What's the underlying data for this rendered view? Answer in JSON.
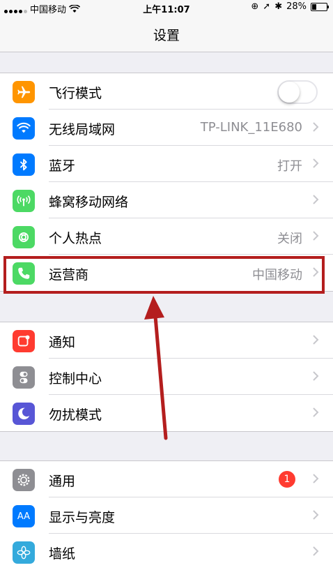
{
  "status_bar": {
    "carrier": "中国移动",
    "time": "上午11:07",
    "battery": "28%",
    "battery_level": 0.28,
    "icons": [
      "signal-dots",
      "wifi-icon",
      "orientation-lock-icon",
      "location-icon",
      "bluetooth-icon",
      "battery-icon"
    ]
  },
  "nav": {
    "title": "设置"
  },
  "group1": [
    {
      "label": "飞行模式",
      "icon": "airplane-icon",
      "color": "#ff9500",
      "control": "toggle",
      "toggle_on": false
    },
    {
      "label": "无线局域网",
      "icon": "wifi-icon",
      "color": "#007aff",
      "value": "TP-LINK_11E680"
    },
    {
      "label": "蓝牙",
      "icon": "bluetooth-icon",
      "color": "#007aff",
      "value": "打开"
    },
    {
      "label": "蜂窝移动网络",
      "icon": "cellular-icon",
      "color": "#4cd964"
    },
    {
      "label": "个人热点",
      "icon": "hotspot-icon",
      "color": "#4cd964",
      "value": "关闭"
    },
    {
      "label": "运营商",
      "icon": "phone-icon",
      "color": "#4cd964",
      "value": "中国移动",
      "highlighted": true
    }
  ],
  "group2": [
    {
      "label": "通知",
      "icon": "notifications-icon",
      "color": "#ff3b30"
    },
    {
      "label": "控制中心",
      "icon": "control-center-icon",
      "color": "#8e8e93"
    },
    {
      "label": "勿扰模式",
      "icon": "moon-icon",
      "color": "#5856d6"
    }
  ],
  "group3": [
    {
      "label": "通用",
      "icon": "gear-icon",
      "color": "#8e8e93",
      "badge": "1"
    },
    {
      "label": "显示与亮度",
      "icon": "display-brightness-icon",
      "color": "#007aff",
      "icon_text": "AA"
    },
    {
      "label": "墙纸",
      "icon": "wallpaper-icon",
      "color": "#34aadc"
    }
  ],
  "annotation_color": "#b41e1e"
}
